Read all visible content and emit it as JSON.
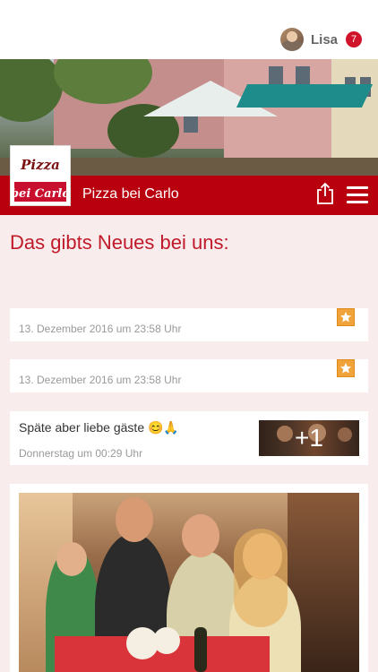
{
  "user": {
    "name": "Lisa",
    "notifications": "7"
  },
  "header": {
    "title": "Pizza bei Carlo",
    "logo_text": "Pizza bei Carlo"
  },
  "section_title": "Das gibts Neues bei uns:",
  "posts": [
    {
      "date": "13. Dezember 2016 um 23:58 Uhr"
    },
    {
      "date": "13. Dezember 2016 um 23:58 Uhr"
    },
    {
      "text": "Späte aber liebe gäste 😊🙏",
      "date": "Donnerstag um 00:29 Uhr",
      "more": "+1"
    }
  ],
  "colors": {
    "brand": "#b8000f",
    "accent": "#c0192a",
    "star": "#f0a33a",
    "background": "#f9ecec"
  },
  "icons": {
    "share": "share-icon",
    "menu": "hamburger-menu-icon",
    "star": "star-icon"
  }
}
